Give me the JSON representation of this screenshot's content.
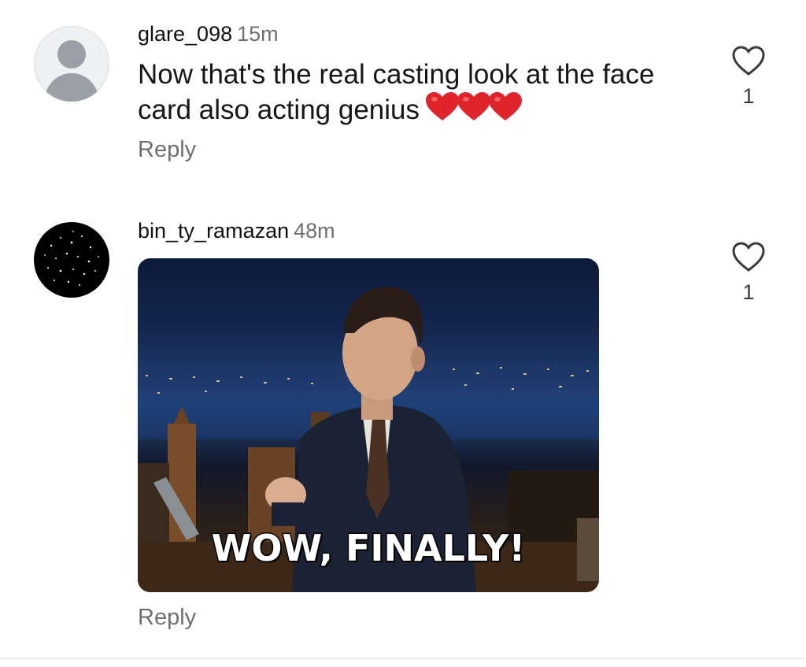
{
  "comments": [
    {
      "username": "glare_098",
      "time": "15m",
      "text": "Now that's the real casting look at the face card also acting genius",
      "emoji": "❤️❤️❤️",
      "reply_label": "Reply",
      "like_count": "1"
    },
    {
      "username": "bin_ty_ramazan",
      "time": "48m",
      "gif_caption": "WOW, FINALLY!",
      "reply_label": "Reply",
      "like_count": "1"
    }
  ],
  "colors": {
    "text": "#111111",
    "muted": "#6f6f6f",
    "heart_emoji": "#e0242c",
    "avatar_default_bg": "#eef0f2"
  }
}
